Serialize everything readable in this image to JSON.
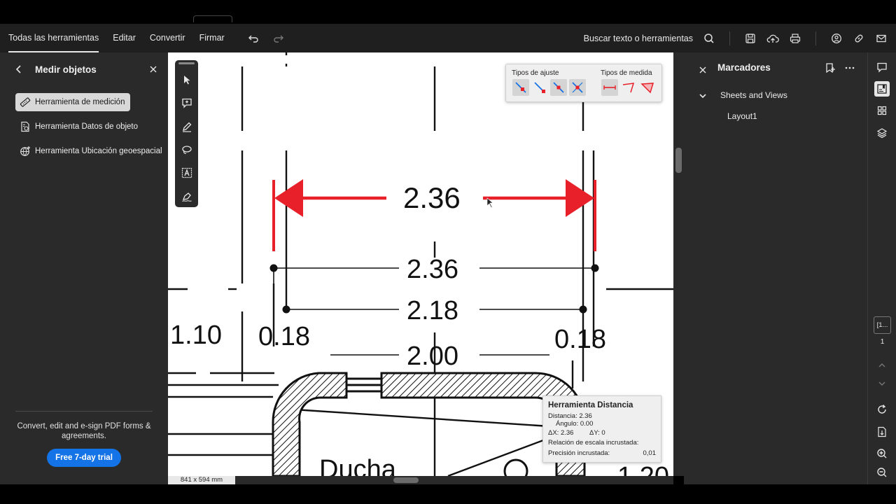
{
  "menubar": {
    "items": [
      "Todas las herramientas",
      "Editar",
      "Convertir",
      "Firmar"
    ],
    "search_label": "Buscar texto o herramientas"
  },
  "left_panel": {
    "title": "Medir objetos",
    "tools": [
      {
        "label": "Herramienta de medición",
        "icon": "ruler-icon",
        "selected": true
      },
      {
        "label": "Herramienta Datos de objeto",
        "icon": "object-data-icon",
        "selected": false
      },
      {
        "label": "Herramienta Ubicación geoespacial",
        "icon": "geospatial-icon",
        "selected": false
      }
    ],
    "promo_text": "Convert, edit and e-sign PDF forms & agreements.",
    "trial_button": "Free 7-day trial"
  },
  "snap_panel": {
    "snap_label": "Tipos de ajuste",
    "measure_label": "Tipos de medida"
  },
  "drawing": {
    "measure_value": "2.36",
    "dims": [
      "2.36",
      "2.18",
      "2.00",
      "1.10",
      "0.18",
      "0.18"
    ],
    "room_label": "Ducha",
    "partial_label": "1.20"
  },
  "distance_box": {
    "title": "Herramienta Distancia",
    "distance": "Distancia:  2.36",
    "angle": "Ángulo:  0.00",
    "dx": "ΔX:  2.36",
    "dy": "ΔY:  0",
    "scale": "Relación de escala incrustada:",
    "precision_label": "Precisión incrustada:",
    "precision_value": "0,01"
  },
  "status": {
    "page_size": "841 x 594 mm"
  },
  "right_panel": {
    "title": "Marcadores",
    "tree": [
      {
        "label": "Sheets and Views",
        "level": 0
      },
      {
        "label": "Layout1",
        "level": 1
      }
    ]
  },
  "page_nav": {
    "current": "[1...",
    "total": "1"
  },
  "colors": {
    "accent": "#1473e6",
    "measure_red": "#e8202a",
    "panel_bg": "#2a2a2a"
  }
}
